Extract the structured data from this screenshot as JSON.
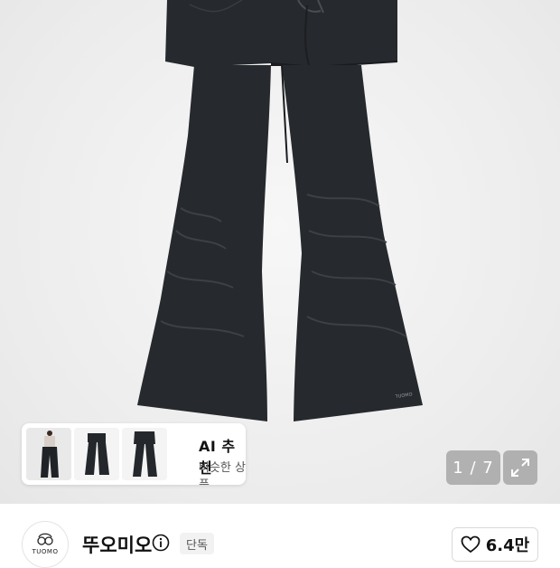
{
  "product": {
    "image_label": "product photo: black flared pants with wrap skirt layer",
    "garment_logo_text": "TUOMO"
  },
  "ai_recommend": {
    "title": "AI 추천",
    "subtitle": "비슷한 상품"
  },
  "gallery": {
    "counter": "1 / 7"
  },
  "brand": {
    "logo_text": "TUOMO",
    "name": "뚜오미오",
    "badge": "단독"
  },
  "like": {
    "count": "6.4만"
  },
  "colors": {
    "garment": "#26292d",
    "accent_text": "#111111"
  }
}
